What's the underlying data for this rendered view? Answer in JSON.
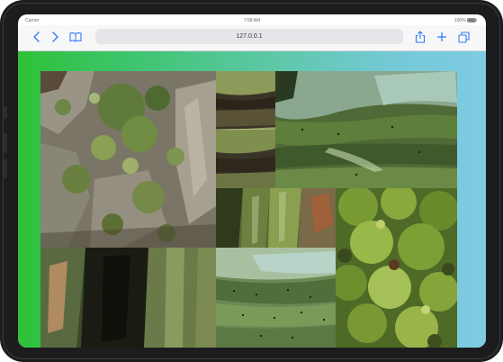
{
  "status_bar": {
    "carrier": "Carrier",
    "time": "7:58 AM",
    "battery": "100%"
  },
  "toolbar": {
    "url": "127.0.0.1",
    "icons": [
      "chevron-left-icon",
      "chevron-right-icon",
      "book-icon",
      "share-icon",
      "plus-icon",
      "tabs-icon"
    ]
  },
  "page": {
    "gradient_colors": [
      "#2fc138",
      "#7fcbe3"
    ],
    "gallery_images": [
      "lichen-bark",
      "bark-strips",
      "green-bark",
      "mossy-wood",
      "dark-tree-hollow",
      "pale-green-bark",
      "moss-clump"
    ]
  }
}
